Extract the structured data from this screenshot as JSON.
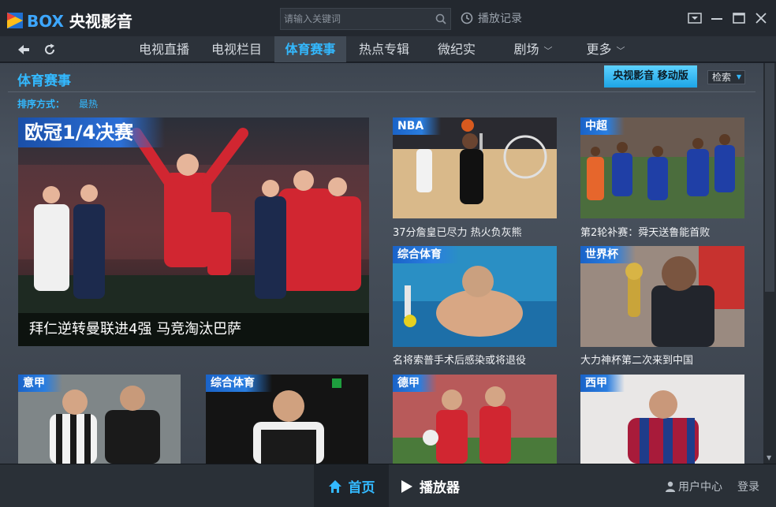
{
  "app": {
    "logo_box": "BOX",
    "logo_cn": "央视影音"
  },
  "search": {
    "placeholder": "请输入关键词"
  },
  "history_label": "播放记录",
  "nav": {
    "items": [
      {
        "label": "电视直播"
      },
      {
        "label": "电视栏目"
      },
      {
        "label": "体育赛事"
      },
      {
        "label": "热点专辑"
      },
      {
        "label": "微纪实"
      },
      {
        "label": "剧场"
      },
      {
        "label": "更多"
      }
    ],
    "active": "体育赛事"
  },
  "section": {
    "title": "体育赛事",
    "mobile_button": "央视影音 移动版",
    "search_dropdown": "检索",
    "sort_label": "排序方式：",
    "sort_value": "最热"
  },
  "featured": {
    "tag": "欧冠1/4决赛",
    "caption": "拜仁逆转曼联进4强 马竞淘汰巴萨"
  },
  "tiles": [
    {
      "tag": "NBA",
      "caption": "37分詹皇已尽力 热火负灰熊"
    },
    {
      "tag": "中超",
      "caption": "第2轮补赛：舜天送鲁能首败"
    },
    {
      "tag": "综合体育",
      "caption": "名将索普手术后感染或将退役"
    },
    {
      "tag": "世界杯",
      "caption": "大力神杯第二次来到中国"
    },
    {
      "tag": "意甲",
      "caption": ""
    },
    {
      "tag": "综合体育",
      "caption": ""
    },
    {
      "tag": "德甲",
      "caption": ""
    },
    {
      "tag": "西甲",
      "caption": ""
    }
  ],
  "footer": {
    "home": "首页",
    "player": "播放器",
    "user_center": "用户中心",
    "login": "登录"
  },
  "colors": {
    "accent": "#33b9ff",
    "background": "#1b2028"
  }
}
